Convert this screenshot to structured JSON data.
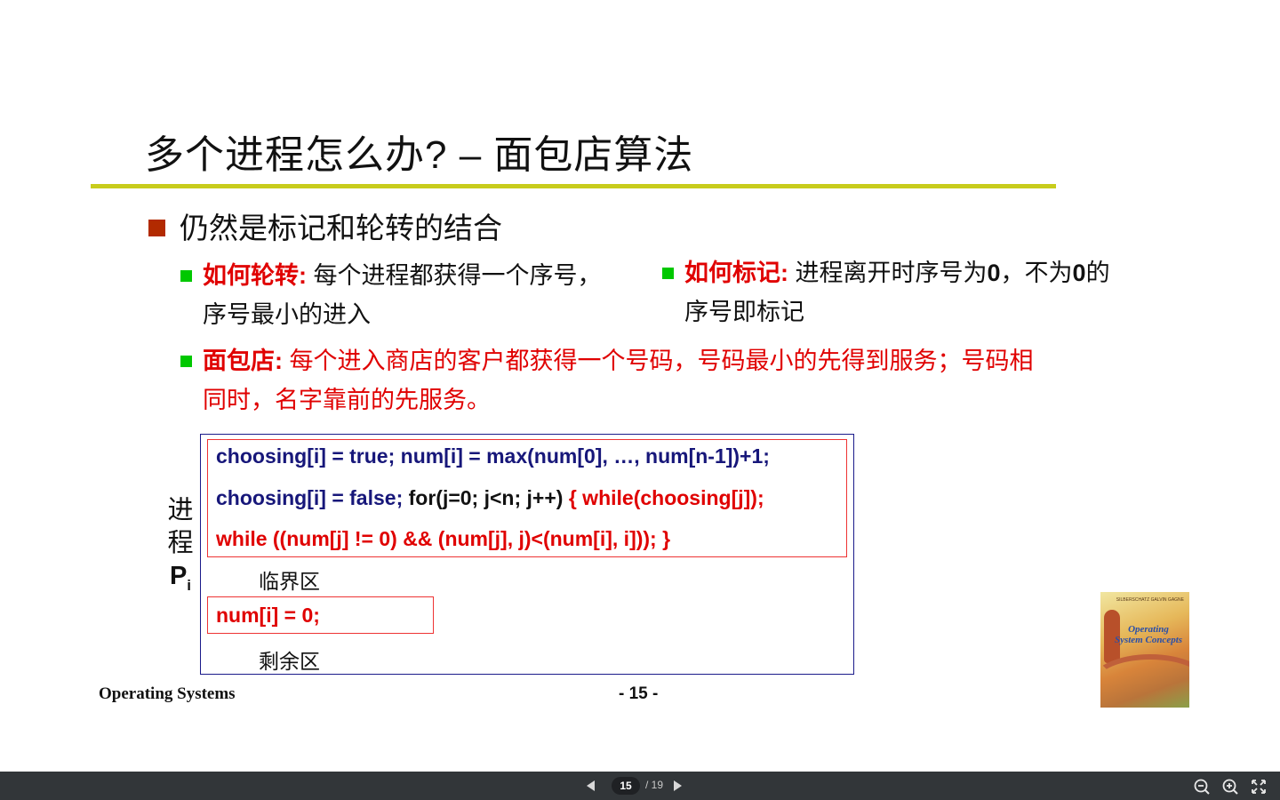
{
  "slide": {
    "title": "多个进程怎么办? – 面包店算法",
    "main_bullet": "仍然是标记和轮转的结合",
    "sub_a": {
      "lead": "如何轮转:",
      "text1": " 每个进程都获得一个序号，",
      "text2": "序号最小的进入"
    },
    "sub_b": {
      "lead": "如何标记:",
      "text1a": " 进程离开时序号为",
      "zero1": "0",
      "text1b": "，不为",
      "zero2": "0",
      "text1c": "的",
      "text2": "序号即标记"
    },
    "sub_c": {
      "lead": "面包店:",
      "text1": " 每个进入商店的客户都获得一个号码，号码最小的先得到服务；号码相",
      "text2": "同时，名字靠前的先服务。"
    },
    "code": {
      "line1": "choosing[i] = true; num[i] = max(num[0], …, num[n-1])+1;",
      "line2_navy": "choosing[i] = false; ",
      "line2_black": "for(j=0; j<n; j++) ",
      "line2_red": "{ while(choosing[j]);",
      "line3": "while ((num[j] != 0) && (num[j], j)<(num[i], i])); }",
      "critical": "临界区",
      "reset": "num[i] = 0;",
      "remainder": "剩余区"
    },
    "process_label": {
      "char1": "进",
      "char2": "程",
      "p": "P",
      "sub": "i"
    },
    "footer": {
      "course": "Operating Systems",
      "page": "- 15 -"
    },
    "book_cover": {
      "authors": "SILBERSCHATZ GALVIN GAGNE",
      "title": "Operating System Concepts"
    }
  },
  "viewer": {
    "current_page": "15",
    "total_pages": "/ 19"
  },
  "colors": {
    "title_rule": "#c8cc1c",
    "bullet_red": "#b22a00",
    "bullet_green": "#00c800",
    "emphasis_red": "#e00000",
    "code_navy": "#17177a",
    "toolbar_bg": "#323639"
  }
}
